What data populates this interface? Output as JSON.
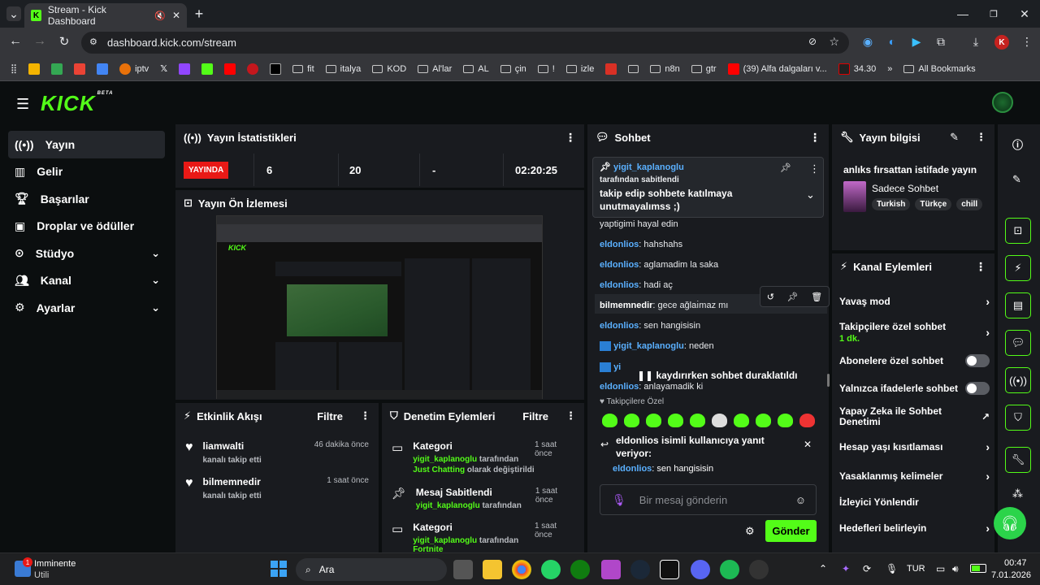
{
  "browser": {
    "tab_title": "Stream - Kick Dashboard",
    "url": "dashboard.kick.com/stream",
    "bookmarks": [
      "iptv",
      "fit",
      "italya",
      "KOD",
      "Al'lar",
      "AL",
      "çin",
      "!",
      "izle",
      "n8n",
      "gtr",
      "(39) Alfa dalgaları v...",
      "34.30",
      "All Bookmarks"
    ],
    "profile_initial": "K"
  },
  "app": {
    "logo": "KICK",
    "beta": "BETA",
    "nav": [
      {
        "label": "Yayın",
        "icon": "broadcast-icon",
        "active": true
      },
      {
        "label": "Gelir",
        "icon": "chart-icon"
      },
      {
        "label": "Başarılar",
        "icon": "trophy-icon"
      },
      {
        "label": "Droplar ve ödüller",
        "icon": "gift-icon"
      },
      {
        "label": "Stüdyo",
        "icon": "studio-icon",
        "expandable": true
      },
      {
        "label": "Kanal",
        "icon": "users-icon",
        "expandable": true
      },
      {
        "label": "Ayarlar",
        "icon": "gear-icon",
        "expandable": true
      }
    ]
  },
  "stats": {
    "title": "Yayın İstatistikleri",
    "live": "YAYINDA",
    "viewers": "6",
    "followers": "20",
    "dash": "-",
    "uptime": "02:20:25"
  },
  "preview": {
    "title": "Yayın Ön İzlemesi"
  },
  "activity": {
    "title": "Etkinlik Akışı",
    "filter": "Filtre",
    "items": [
      {
        "user": "liamwalti",
        "action": "kanalı takip etti",
        "time": "46 dakika önce"
      },
      {
        "user": "bilmemnedir",
        "action": "kanalı takip etti",
        "time": "1 saat önce"
      }
    ]
  },
  "moderation": {
    "title": "Denetim Eylemleri",
    "filter": "Filtre",
    "items": [
      {
        "title": "Kategori",
        "user": "yigit_kaplanoglu",
        "pre": "tarafından",
        "value": "Just Chatting",
        "post": "olarak değiştirildi",
        "time": "1 saat önce"
      },
      {
        "title": "Mesaj Sabitlendi",
        "user": "yigit_kaplanoglu",
        "pre": "tarafından",
        "value": "",
        "post": "",
        "time": "1 saat önce"
      },
      {
        "title": "Kategori",
        "user": "yigit_kaplanoglu",
        "pre": "tarafından",
        "value": "Fortnite",
        "post": "",
        "time": "1 saat önce"
      }
    ]
  },
  "chat": {
    "title": "Sohbet",
    "pinned_user": "yigit_kaplanoglu",
    "pinned_by": "tarafından sabitlendi",
    "pinned_text": "takip edip sohbete katılmaya unutmayalımss ;)",
    "messages": [
      {
        "user": "",
        "text": "yaptigimi hayal edin"
      },
      {
        "user": "eldonlios",
        "text": "hahshahs"
      },
      {
        "user": "eldonlios",
        "text": "aglamadim la saka"
      },
      {
        "user": "eldonlios",
        "text": "hadi aç"
      },
      {
        "user": "bilmemnedir",
        "text": "gece ağlaı̇maz mı"
      },
      {
        "user": "eldonlios",
        "text": "sen hangisisin"
      },
      {
        "user": "yigit_kaplanoglu",
        "text": "neden"
      },
      {
        "user": "eldonlios",
        "text": "anlayamadik ki"
      }
    ],
    "paused": "kaydırırken sohbet duraklatıldı",
    "followers_only": "Takipçilere Özel",
    "reply_title": "eldonlios isimli kullanıcıya yanıt veriyor:",
    "reply_user": "eldonlios",
    "reply_text": "sen hangisisin",
    "placeholder": "Bir mesaj gönderin",
    "send": "Gönder"
  },
  "stream_info": {
    "title": "Yayın bilgisi",
    "stream_title": "anlıks fırsattan istifade yayın",
    "category": "Sadece Sohbet",
    "tags": [
      "Turkish",
      "Türkçe",
      "chill"
    ]
  },
  "channel_actions": {
    "title": "Kanal Eylemleri",
    "slow": "Yavaş mod",
    "followers_chat": "Takipçilere özel sohbet",
    "followers_min": "1 dk.",
    "subs_chat": "Abonelere özel sohbet",
    "emote_chat": "Yalnızca ifadelerle sohbet",
    "ai_mod": "Yapay Zeka ile Sohbet Denetimi",
    "age": "Hesap yaşı kısıtlaması",
    "banned_words": "Yasaklanmış kelimeler",
    "redirect": "İzleyici Yönlendir",
    "goals": "Hedefleri belirleyin"
  },
  "taskbar": {
    "weather_title": "Imminente",
    "weather_sub": "Utili",
    "search": "Ara",
    "lang": "TUR",
    "time": "00:47",
    "date": "7.01.2026"
  },
  "colors": {
    "accent": "#53fc18",
    "live": "#e91916",
    "panel": "#191b1f"
  }
}
